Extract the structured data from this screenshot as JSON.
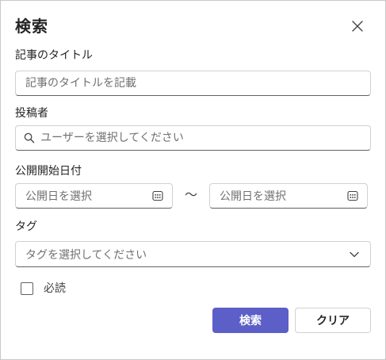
{
  "dialog": {
    "title": "検索",
    "close_icon": "close-icon"
  },
  "article_title": {
    "label": "記事のタイトル",
    "placeholder": "記事のタイトルを記載",
    "value": ""
  },
  "author": {
    "label": "投稿者",
    "placeholder": "ユーザーを選択してください",
    "icon": "search-icon"
  },
  "publish_start_date": {
    "label": "公開開始日付",
    "from_placeholder": "公開日を選択",
    "to_placeholder": "公開日を選択",
    "separator": "～",
    "icon": "calendar-icon"
  },
  "tag": {
    "label": "タグ",
    "placeholder": "タグを選択してください",
    "icon": "chevron-down-icon"
  },
  "required_reading": {
    "label": "必読",
    "checked": false
  },
  "actions": {
    "search_label": "検索",
    "clear_label": "クリア"
  },
  "colors": {
    "primary": "#5b5fc7",
    "border": "#d1d1d1",
    "text": "#242424",
    "placeholder": "#707070"
  }
}
